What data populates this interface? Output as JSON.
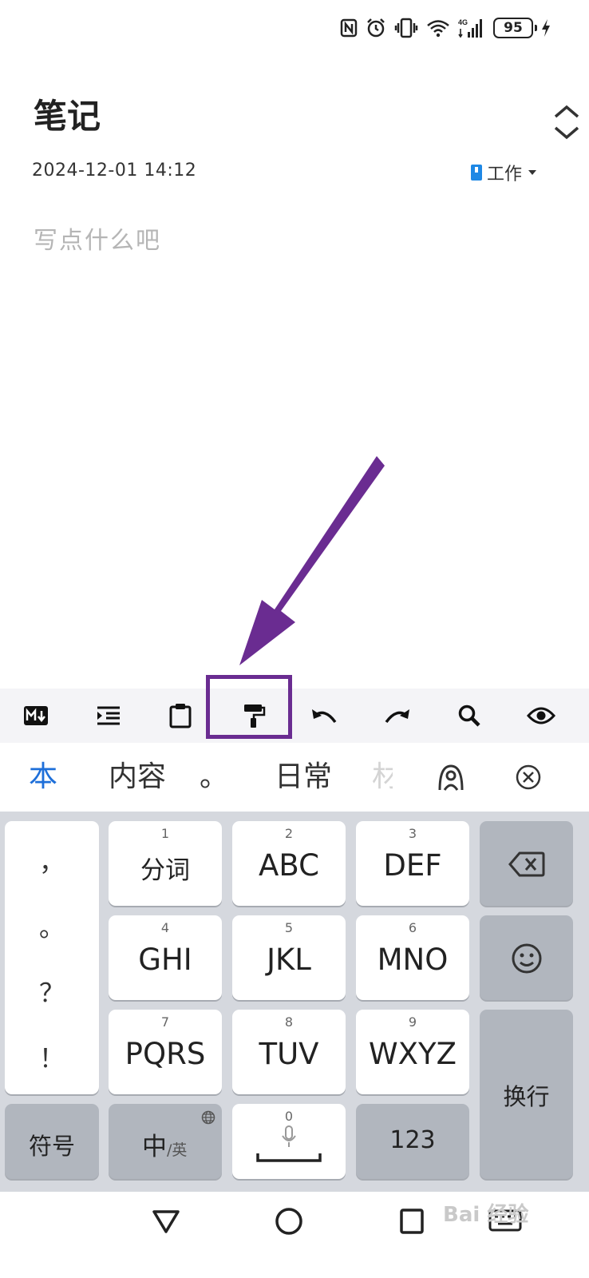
{
  "status_bar": {
    "battery_level": "95",
    "network": "4G",
    "icons": [
      "nfc-icon",
      "alarm-icon",
      "vibrate-icon",
      "wifi-icon",
      "signal-icon",
      "battery-icon",
      "charging-icon"
    ]
  },
  "note": {
    "title": "笔记",
    "date": "2024-12-01 14:12",
    "category": "工作",
    "placeholder": "写点什么吧"
  },
  "toolbar": {
    "items": [
      {
        "name": "markdown",
        "label": "M↓"
      },
      {
        "name": "indent"
      },
      {
        "name": "clipboard"
      },
      {
        "name": "format-painter"
      },
      {
        "name": "undo"
      },
      {
        "name": "redo"
      },
      {
        "name": "search"
      },
      {
        "name": "preview"
      }
    ],
    "highlighted_item": "format-painter",
    "annotation_color": "#6a2c91"
  },
  "candidates": {
    "items": [
      "本",
      "内容",
      "。",
      "日常",
      "材"
    ]
  },
  "keyboard": {
    "punctuation": [
      "，",
      "。",
      "？",
      "！"
    ],
    "keys": [
      {
        "num": "1",
        "label": "分词"
      },
      {
        "num": "2",
        "label": "ABC"
      },
      {
        "num": "3",
        "label": "DEF"
      },
      {
        "num": "4",
        "label": "GHI"
      },
      {
        "num": "5",
        "label": "JKL"
      },
      {
        "num": "6",
        "label": "MNO"
      },
      {
        "num": "7",
        "label": "PQRS"
      },
      {
        "num": "8",
        "label": "TUV"
      },
      {
        "num": "9",
        "label": "WXYZ"
      }
    ],
    "symbols_label": "符号",
    "lang_main": "中",
    "lang_alt": "/英",
    "space_num": "0",
    "numbers_label": "123",
    "enter_label": "换行"
  },
  "watermark": "Bai 经验",
  "colors": {
    "accent_blue": "#1e6fd9",
    "keyboard_bg": "#d5d8de",
    "key_gray": "#b1b6be",
    "toolbar_bg": "#f4f4f7"
  }
}
